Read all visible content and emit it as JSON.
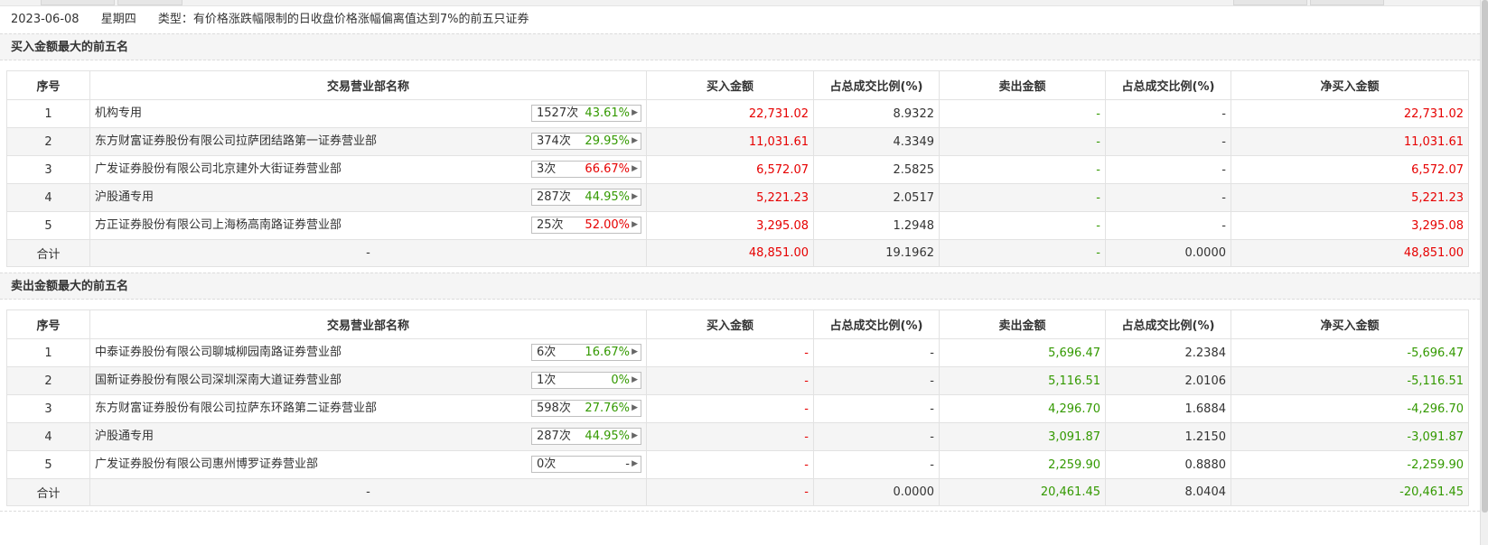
{
  "header": {
    "date": "2023-06-08",
    "weekday": "星期四",
    "type_label": "类型：",
    "type_value": "有价格涨跌幅限制的日收盘价格涨幅偏离值达到7%的前五只证券"
  },
  "columns": {
    "seq": "序号",
    "name": "交易营业部名称",
    "buy": "买入金额",
    "buy_ratio": "占总成交比例(%)",
    "sell": "卖出金额",
    "sell_ratio": "占总成交比例(%)",
    "net": "净买入金额"
  },
  "buy_section": {
    "title": "买入金额最大的前五名",
    "rows": [
      {
        "seq": "1",
        "name": "机构专用",
        "count": "1527次",
        "rate": "43.61%",
        "buy": "22,731.02",
        "buy_ratio": "8.9322",
        "sell": "-",
        "sell_ratio": "-",
        "net": "22,731.02"
      },
      {
        "seq": "2",
        "name": "东方财富证券股份有限公司拉萨团结路第一证券营业部",
        "count": "374次",
        "rate": "29.95%",
        "buy": "11,031.61",
        "buy_ratio": "4.3349",
        "sell": "-",
        "sell_ratio": "-",
        "net": "11,031.61"
      },
      {
        "seq": "3",
        "name": "广发证券股份有限公司北京建外大街证券营业部",
        "count": "3次",
        "rate": "66.67%",
        "buy": "6,572.07",
        "buy_ratio": "2.5825",
        "sell": "-",
        "sell_ratio": "-",
        "net": "6,572.07"
      },
      {
        "seq": "4",
        "name": "沪股通专用",
        "count": "287次",
        "rate": "44.95%",
        "buy": "5,221.23",
        "buy_ratio": "2.0517",
        "sell": "-",
        "sell_ratio": "-",
        "net": "5,221.23"
      },
      {
        "seq": "5",
        "name": "方正证券股份有限公司上海杨高南路证券营业部",
        "count": "25次",
        "rate": "52.00%",
        "buy": "3,295.08",
        "buy_ratio": "1.2948",
        "sell": "-",
        "sell_ratio": "-",
        "net": "3,295.08"
      }
    ],
    "total": {
      "label": "合计",
      "name": "-",
      "buy": "48,851.00",
      "buy_ratio": "19.1962",
      "sell": "-",
      "sell_ratio": "0.0000",
      "net": "48,851.00"
    }
  },
  "sell_section": {
    "title": "卖出金额最大的前五名",
    "rows": [
      {
        "seq": "1",
        "name": "中泰证券股份有限公司聊城柳园南路证券营业部",
        "count": "6次",
        "rate": "16.67%",
        "buy": "-",
        "buy_ratio": "-",
        "sell": "5,696.47",
        "sell_ratio": "2.2384",
        "net": "-5,696.47"
      },
      {
        "seq": "2",
        "name": "国新证券股份有限公司深圳深南大道证券营业部",
        "count": "1次",
        "rate": "0%",
        "buy": "-",
        "buy_ratio": "-",
        "sell": "5,116.51",
        "sell_ratio": "2.0106",
        "net": "-5,116.51"
      },
      {
        "seq": "3",
        "name": "东方财富证券股份有限公司拉萨东环路第二证券营业部",
        "count": "598次",
        "rate": "27.76%",
        "buy": "-",
        "buy_ratio": "-",
        "sell": "4,296.70",
        "sell_ratio": "1.6884",
        "net": "-4,296.70"
      },
      {
        "seq": "4",
        "name": "沪股通专用",
        "count": "287次",
        "rate": "44.95%",
        "buy": "-",
        "buy_ratio": "-",
        "sell": "3,091.87",
        "sell_ratio": "1.2150",
        "net": "-3,091.87"
      },
      {
        "seq": "5",
        "name": "广发证券股份有限公司惠州博罗证券营业部",
        "count": "0次",
        "rate": "-",
        "buy": "-",
        "buy_ratio": "-",
        "sell": "2,259.90",
        "sell_ratio": "0.8880",
        "net": "-2,259.90"
      }
    ],
    "total": {
      "label": "合计",
      "name": "-",
      "buy": "-",
      "buy_ratio": "0.0000",
      "sell": "20,461.45",
      "sell_ratio": "8.0404",
      "net": "-20,461.45"
    }
  },
  "colors": {
    "positive": "#e60000",
    "negative": "#339900",
    "row_alt": "#f5f5f5"
  },
  "icons": {
    "badge_arrow": "triangle-right-icon"
  }
}
